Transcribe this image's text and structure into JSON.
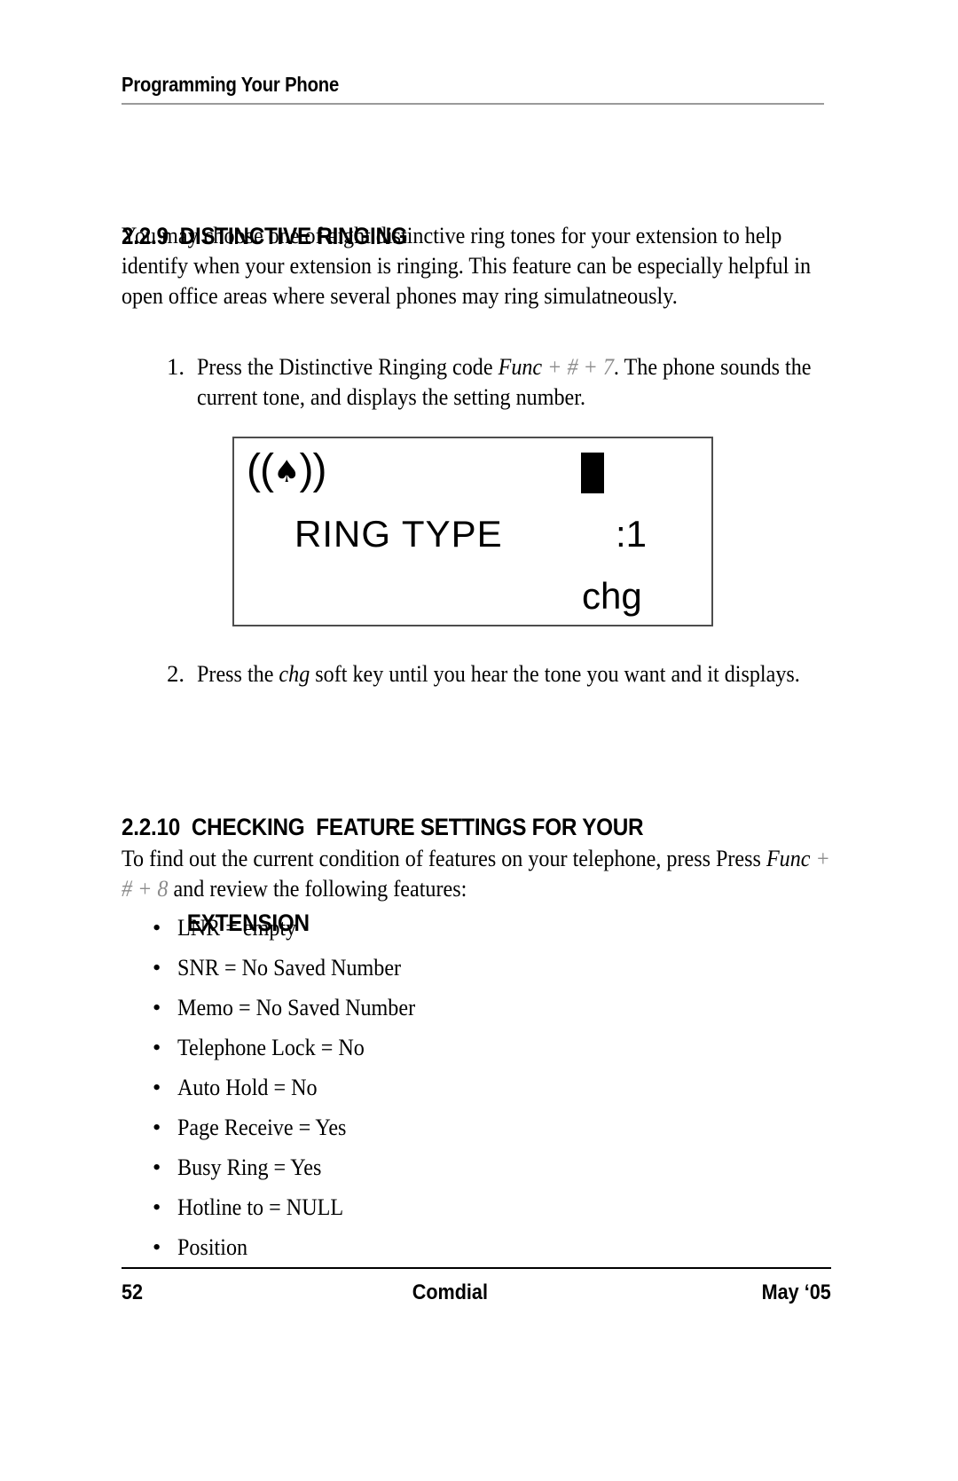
{
  "page": {
    "running_header": "Programming Your Phone",
    "footer": {
      "page_number": "52",
      "company": "Comdial",
      "date": "May ‘05"
    }
  },
  "sections": [
    {
      "number": "2.2.9",
      "title": "DISTINCTIVE RINGING",
      "heading_full": "2.2.9  DISTINCTIVE RINGING",
      "intro": "You may choose one of eight distinctive ring tones for your extension to help identify when your extension is ringing.  This feature can be especially helpful in open office areas where several phones may ring simulatneously.",
      "steps": [
        {
          "number": "1.",
          "text_before": "Press the Distinctive Ringing code ",
          "code_italic": "Func",
          "code_dim": " + # + 7",
          "text_after": ".  The phone sounds the current tone, and displays the setting number."
        },
        {
          "number": "2.",
          "text_before": "Press the ",
          "code_italic": "chg",
          "code_dim": "",
          "text_after": " soft key until you hear the tone you want and it displays."
        }
      ]
    },
    {
      "number": "2.2.10",
      "title_line1": "CHECKING  FEATURE SETTINGS FOR YOUR",
      "title_line2": "EXTENSION",
      "heading_prefix": "2.2.10  ",
      "intro_before": "To find out the current condition of features on your telephone, press Press ",
      "intro_code_italic": "Func",
      "intro_code_dim": " + # + 8",
      "intro_after": " and review the following features:",
      "features": [
        "LNR = empty",
        "SNR = No Saved Number",
        "Memo = No Saved Number",
        "Telephone Lock = No",
        "Auto Hold = No",
        "Page Receive = Yes",
        "Busy Ring = Yes",
        "Hotline to = NULL",
        "Position"
      ],
      "bullet_glyph": "•"
    }
  ],
  "lcd_display": {
    "ring_icon_left_parens": "((",
    "ring_icon_bell": "♠",
    "ring_icon_right_parens": "))",
    "cursor_block": "",
    "label": "RING TYPE",
    "value": ":1",
    "soft_key": "chg",
    "border_color": "#4d4d4d",
    "background": "#ffffff"
  }
}
